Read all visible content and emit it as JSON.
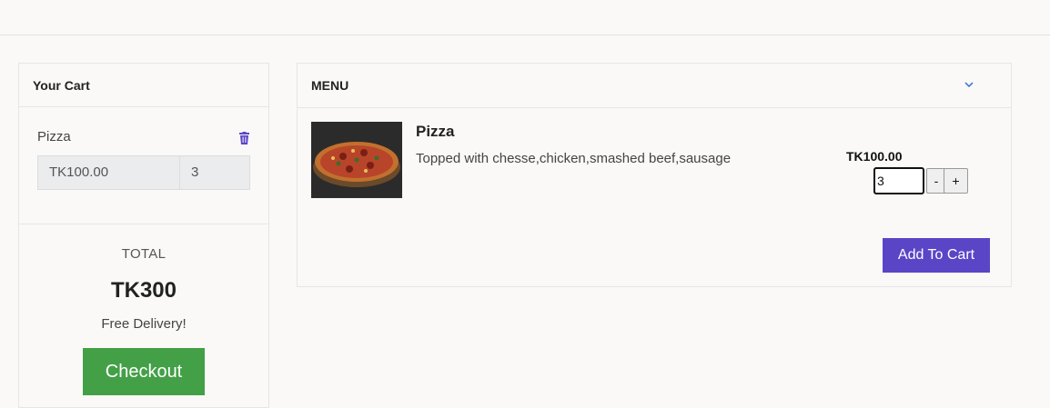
{
  "cart": {
    "title": "Your Cart",
    "items": [
      {
        "name": "Pizza",
        "price": "TK100.00",
        "quantity": "3"
      }
    ],
    "total_label": "TOTAL",
    "total_value": "TK300",
    "delivery_text": "Free Delivery!",
    "checkout_label": "Checkout"
  },
  "menu": {
    "title": "MENU",
    "items": [
      {
        "name": "Pizza",
        "description": "Topped with chesse,chicken,smashed beef,sausage",
        "price": "TK100.00",
        "quantity": "3",
        "decrement_label": "-",
        "increment_label": "+",
        "add_label": "Add To Cart"
      }
    ]
  },
  "colors": {
    "accent_purple": "#5b45c7",
    "checkout_green": "#43a047",
    "chevron_blue": "#2a6fd6"
  },
  "icons": [
    "trash-icon",
    "chevron-down-icon",
    "pizza-image"
  ]
}
